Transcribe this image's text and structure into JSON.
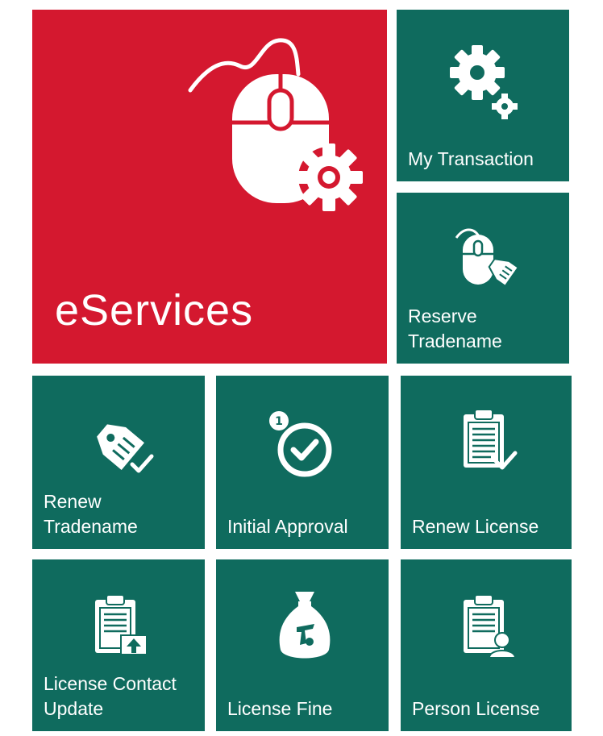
{
  "colors": {
    "primary_tile": "#d4182f",
    "secondary_tile": "#0f6b5e",
    "tile_text": "#ffffff"
  },
  "main_tile": {
    "label": "eServices",
    "icon": "mouse-gear-icon"
  },
  "tiles": [
    {
      "label": "My Transaction",
      "icon": "gears-icon"
    },
    {
      "label": "Reserve\nTradename",
      "icon": "mouse-tag-icon"
    },
    {
      "label": "Renew\nTradename",
      "icon": "tag-check-icon"
    },
    {
      "label": "Initial Approval",
      "icon": "approval-check-icon"
    },
    {
      "label": "Renew License",
      "icon": "clipboard-check-icon"
    },
    {
      "label": "License Contact\nUpdate",
      "icon": "clipboard-upload-icon"
    },
    {
      "label": "License Fine",
      "icon": "money-bag-icon"
    },
    {
      "label": "Person License",
      "icon": "clipboard-person-icon"
    }
  ],
  "approval_badge": "1"
}
